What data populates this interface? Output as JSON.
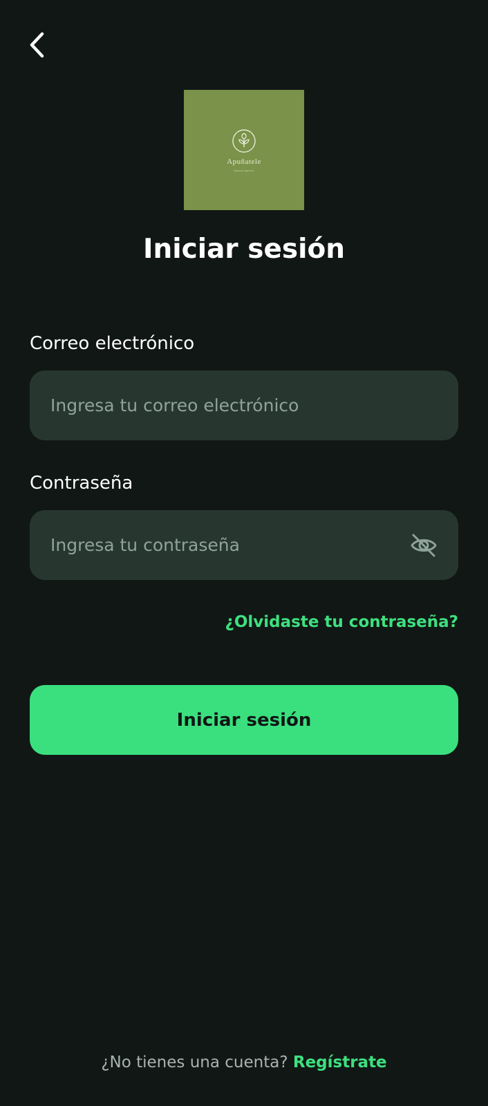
{
  "header": {
    "back_icon": "chevron-left-icon"
  },
  "logo": {
    "name": "Apuñatele",
    "tagline": "asesoría agrícola",
    "background": "#7a9249",
    "icon": "leaf-sprout-icon"
  },
  "title": "Iniciar sesión",
  "email": {
    "label": "Correo electrónico",
    "placeholder": "Ingresa tu correo electrónico",
    "value": ""
  },
  "password": {
    "label": "Contraseña",
    "placeholder": "Ingresa tu contraseña",
    "value": "",
    "toggle_icon": "eye-off-icon"
  },
  "forgot_password": "¿Olvidaste tu contraseña?",
  "submit_label": "Iniciar sesión",
  "footer": {
    "prompt": "¿No tienes una cuenta?",
    "register_label": "Regístrate"
  },
  "colors": {
    "background": "#111715",
    "input_background": "#27372f",
    "accent": "#3ae07e",
    "placeholder": "#8fa39a"
  }
}
